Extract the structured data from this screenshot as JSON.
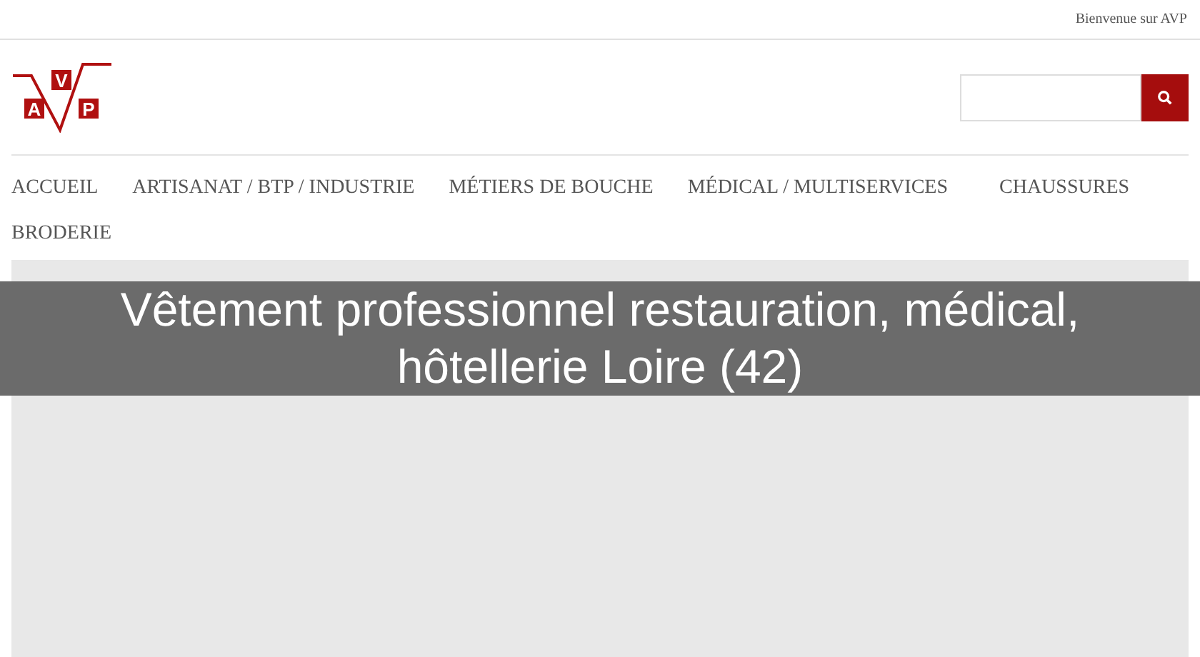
{
  "top_bar": {
    "welcome": "Bienvenue sur AVP"
  },
  "logo": {
    "letters": [
      "A",
      "V",
      "P"
    ]
  },
  "nav": [
    {
      "label": "ACCUEIL"
    },
    {
      "label": "ARTISANAT / BTP / INDUSTRIE"
    },
    {
      "label": "MÉTIERS DE BOUCHE"
    },
    {
      "label": "MÉDICAL / MULTISERVICES"
    },
    {
      "label": "CHAUSSURES"
    },
    {
      "label": "BRODERIE"
    }
  ],
  "banner": {
    "title": "Vêtement professionnel restauration, médical, hôtellerie Loire (42)"
  }
}
